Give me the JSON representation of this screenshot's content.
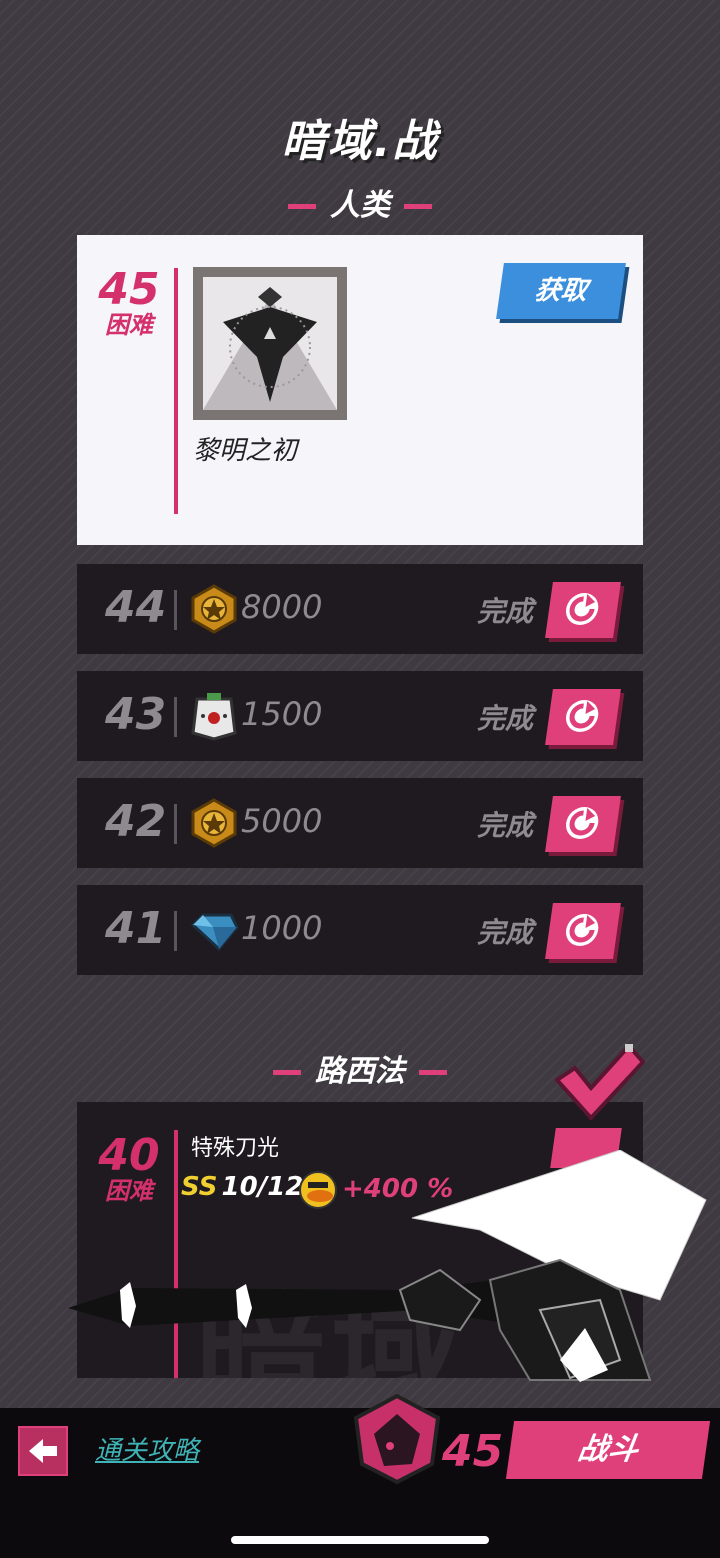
{
  "header": {
    "title": "暗域.战"
  },
  "sections": [
    {
      "title": "人类"
    },
    {
      "title": "路西法"
    }
  ],
  "current_stage": {
    "level": "45",
    "difficulty": "困难",
    "reward_name": "黎明之初",
    "get_label": "获取"
  },
  "stages": [
    {
      "level": "44",
      "icon": "gold-medal-icon",
      "amount": "8000",
      "status": "完成"
    },
    {
      "level": "43",
      "icon": "robot-head-icon",
      "amount": "1500",
      "status": "完成"
    },
    {
      "level": "42",
      "icon": "gold-medal-icon",
      "amount": "5000",
      "status": "完成"
    },
    {
      "level": "41",
      "icon": "blue-crystal-icon",
      "amount": "1000",
      "status": "完成"
    }
  ],
  "boss_stage": {
    "level": "40",
    "difficulty": "困难",
    "skill": "特殊刀光",
    "rank": "SS",
    "progress": "10/12",
    "bonus": "+400 %",
    "watermark": "暗域"
  },
  "bottom_bar": {
    "guide_label": "通关攻略",
    "fight_level": "45",
    "fight_label": "战斗"
  },
  "colors": {
    "accent": "#e0407a",
    "blue": "#3b8fdc",
    "card_dark": "#1f1a20",
    "background": "#3f3a41"
  }
}
